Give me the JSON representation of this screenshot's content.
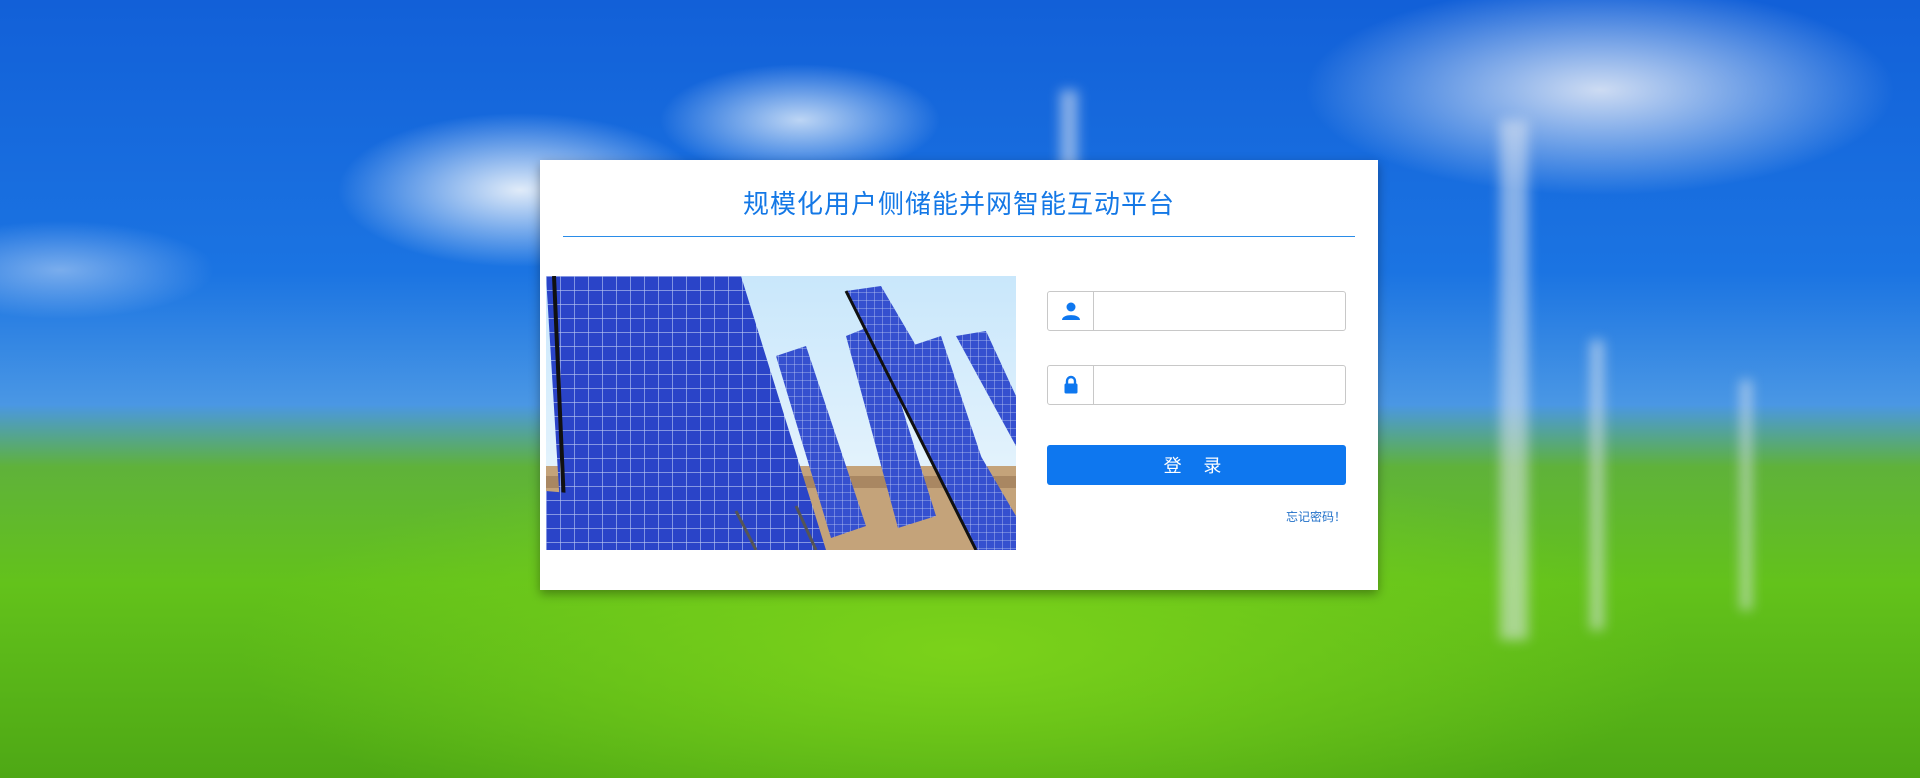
{
  "page": {
    "title": "规模化用户侧储能并网智能互动平台"
  },
  "login": {
    "username_icon": "user-icon",
    "password_icon": "lock-icon",
    "username_value": "",
    "password_value": "",
    "submit_label": "登 录",
    "forgot_label": "忘记密码！"
  },
  "colors": {
    "accent": "#0e77ef",
    "title": "#1478e6",
    "card_bg": "#ffffff"
  }
}
